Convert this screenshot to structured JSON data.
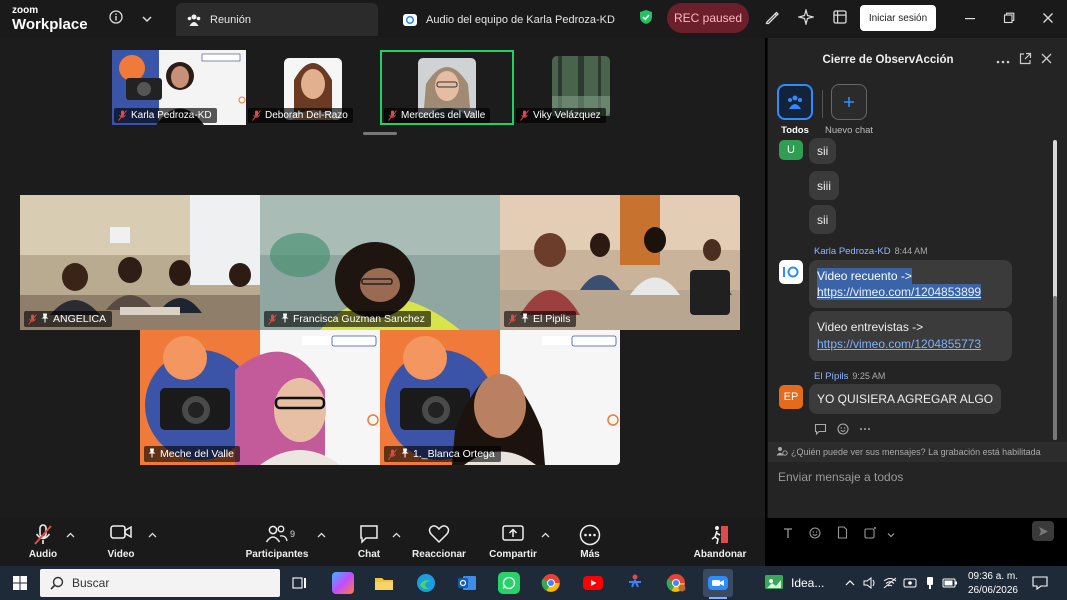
{
  "titlebar": {
    "brand_top": "zoom",
    "brand_bottom": "Workplace",
    "tabs": [
      {
        "label": "Reunión"
      },
      {
        "label": "Audio del equipo de Karla Pedroza-KD"
      }
    ],
    "rec_label": "REC paused",
    "signin_label": "Iniciar sesión"
  },
  "thumbnails": [
    {
      "name": "Karla Pedroza-KD"
    },
    {
      "name": "Deborah Del-Razo"
    },
    {
      "name": "Mercedes del Valle"
    },
    {
      "name": "Viky Velázquez"
    }
  ],
  "tiles": [
    {
      "name": "ANGELICA"
    },
    {
      "name": "Francisca Guzman Sanchez"
    },
    {
      "name": "El Pipils"
    },
    {
      "name": "Meche del Valle"
    },
    {
      "name": "1._Blanca Ortega"
    }
  ],
  "panel": {
    "title": "Cierre de ObservAcción",
    "filters": [
      {
        "label": "Todos"
      },
      {
        "label": "Nuevo chat"
      }
    ],
    "messages": [
      {
        "text": "sii"
      },
      {
        "text": "siii"
      },
      {
        "text": "sii"
      },
      {
        "sender": "Karla Pedroza-KD",
        "time": "8:44 AM",
        "lines": [
          "Video recuento ->",
          "https://vimeo.com/1204853899"
        ]
      },
      {
        "lines": [
          "Video entrevistas ->",
          "https://vimeo.com/1204855773"
        ]
      },
      {
        "sender": "El Pípils",
        "time": "9:25 AM",
        "avatar": "EP",
        "text": "YO QUISIERA AGREGAR ALGO"
      }
    ],
    "first_avatar": "U",
    "notice": "¿Quién puede ver sus mensajes? La grabación está habilitada",
    "composer_placeholder": "Enviar mensaje a todos"
  },
  "toolbar": {
    "audio": "Audio",
    "video": "Video",
    "participants": "Participantes",
    "participants_count": "9",
    "chat": "Chat",
    "react": "Reaccionar",
    "share": "Compartir",
    "more": "Más",
    "leave": "Abandonar"
  },
  "taskbar": {
    "search_placeholder": "Buscar",
    "idea_label": "Idea...",
    "time": "09:36 a. m.",
    "date": "26/06/2026"
  },
  "colors": {
    "rec_bg": "#6b1f2a",
    "accent_blue": "#2d8cff",
    "active_speaker": "#23d160"
  }
}
